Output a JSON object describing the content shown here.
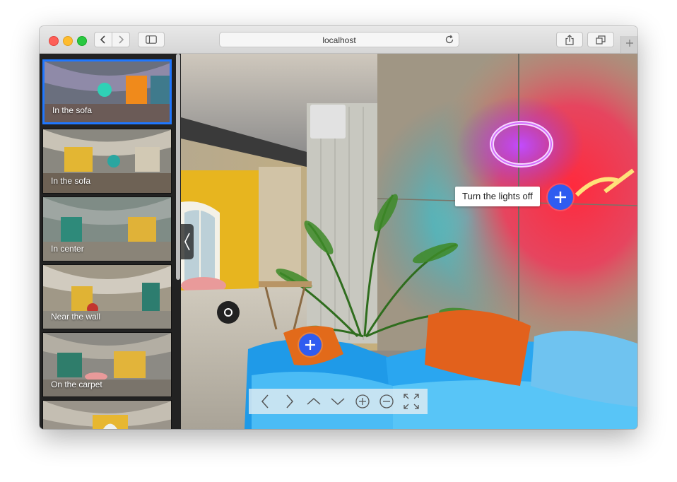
{
  "browser": {
    "url": "localhost",
    "icons": [
      "back-icon",
      "forward-icon",
      "sidebar-icon",
      "reload-icon",
      "share-icon",
      "tabs-icon",
      "plus-icon"
    ]
  },
  "thumbnails": [
    {
      "label": "In the sofa"
    },
    {
      "label": "In the sofa"
    },
    {
      "label": "In center"
    },
    {
      "label": "Near the wall"
    },
    {
      "label": "On the carpet"
    },
    {
      "label": ""
    }
  ],
  "viewer": {
    "tooltip": "Turn the lights off",
    "controls": [
      "left-arrow-icon",
      "right-arrow-icon",
      "up-arrow-icon",
      "down-arrow-icon",
      "zoom-in-icon",
      "zoom-out-icon",
      "fullscreen-icon"
    ]
  },
  "colors": {
    "accent": "#2f5cf0",
    "active_border": "#1f77ff",
    "sidebar_bg": "#222222"
  }
}
